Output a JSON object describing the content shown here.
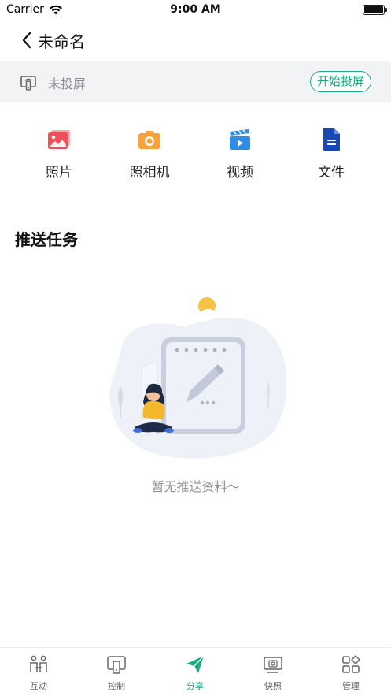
{
  "status_bar": {
    "carrier": "Carrier",
    "time": "9:00 AM"
  },
  "nav": {
    "title": "未命名"
  },
  "cast": {
    "status": "未投屏",
    "start_label": "开始投屏"
  },
  "share_items": [
    {
      "label": "照片",
      "icon": "photo-icon",
      "color": "#ef4f56"
    },
    {
      "label": "照相机",
      "icon": "camera-icon",
      "color": "#f9a23b"
    },
    {
      "label": "视频",
      "icon": "video-icon",
      "color": "#2d8ee8"
    },
    {
      "label": "文件",
      "icon": "file-icon",
      "color": "#1749b5"
    }
  ],
  "section": {
    "title": "推送任务"
  },
  "empty": {
    "text": "暂无推送资料～"
  },
  "tabs": [
    {
      "label": "互动",
      "icon": "interact-icon",
      "active": false
    },
    {
      "label": "控制",
      "icon": "remote-icon",
      "active": false
    },
    {
      "label": "分享",
      "icon": "send-icon",
      "active": true
    },
    {
      "label": "快照",
      "icon": "snapshot-icon",
      "active": false
    },
    {
      "label": "管理",
      "icon": "manage-icon",
      "active": false
    }
  ],
  "colors": {
    "accent": "#1aad84",
    "bar_bg": "#f2f3f5"
  }
}
